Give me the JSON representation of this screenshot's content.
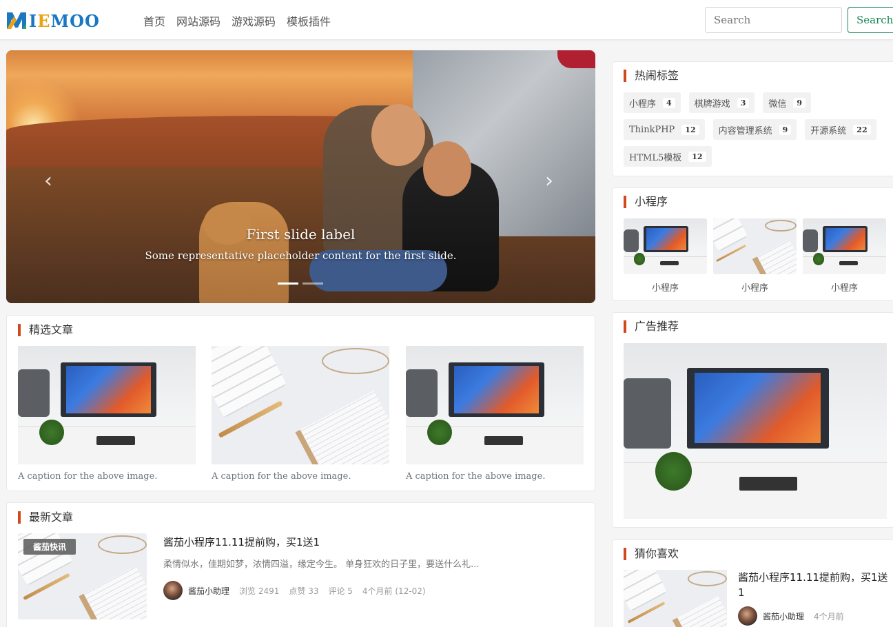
{
  "brand": {
    "logo_text": "IEMOO",
    "logo_icon": "m-logo-icon"
  },
  "nav": {
    "items": [
      "首页",
      "网站源码",
      "游戏源码",
      "模板插件"
    ]
  },
  "search": {
    "placeholder": "Search",
    "button_label": "Search"
  },
  "carousel": {
    "title": "First slide label",
    "text": "Some representative placeholder content for the first slide.",
    "prev_icon": "chevron-left-icon",
    "next_icon": "chevron-right-icon",
    "slide_count": 2,
    "active_index": 0
  },
  "featured": {
    "title": "精选文章",
    "items": [
      {
        "caption": "A caption for the above image."
      },
      {
        "caption": "A caption for the above image."
      },
      {
        "caption": "A caption for the above image."
      }
    ]
  },
  "latest": {
    "title": "最新文章",
    "badge": "酱茄快讯",
    "article_title": "酱茄小程序11.11提前购，买1送1",
    "excerpt": "柔情似水，佳期如梦，浓情四溢，缘定今生。 单身狂欢的日子里，要送什么礼...",
    "author": "酱茄小助理",
    "views": "浏览 2491",
    "likes": "点赞 33",
    "comments": "评论 5",
    "time": "4个月前 (12-02)"
  },
  "tags": {
    "title": "热闹标签",
    "items": [
      {
        "name": "小程序",
        "count": "4"
      },
      {
        "name": "棋牌游戏",
        "count": "3"
      },
      {
        "name": "微信",
        "count": "9"
      },
      {
        "name": "ThinkPHP",
        "count": "12"
      },
      {
        "name": "内容管理系统",
        "count": "9"
      },
      {
        "name": "开源系统",
        "count": "22"
      },
      {
        "name": "HTML5模板",
        "count": "12"
      }
    ]
  },
  "mini": {
    "title": "小程序",
    "items": [
      {
        "label": "小程序"
      },
      {
        "label": "小程序"
      },
      {
        "label": "小程序"
      }
    ]
  },
  "ads": {
    "title": "广告推荐"
  },
  "guess": {
    "title": "猜你喜欢",
    "article_title": "酱茄小程序11.11提前购，买1送1",
    "author": "酱茄小助理",
    "time": "4个月前"
  },
  "colors": {
    "accent_bar": "#d1481c",
    "search_green": "#198754",
    "logo_blue": "#1a78c2",
    "logo_orange": "#e8a317"
  }
}
